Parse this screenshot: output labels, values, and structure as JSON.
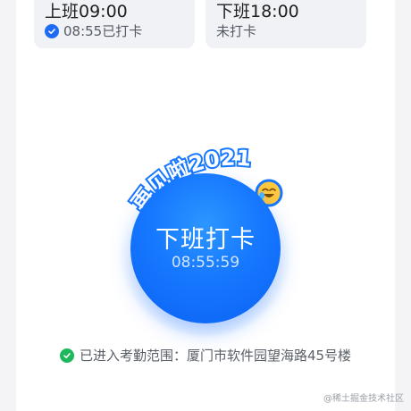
{
  "cards": {
    "clock_in": {
      "title": "上班09:00",
      "status": "08:55已打卡"
    },
    "clock_out": {
      "title": "下班18:00",
      "status": "未打卡"
    }
  },
  "clock_button": {
    "label": "下班打卡",
    "time": "08:55:59",
    "banner_text": "再见啦2021"
  },
  "location": {
    "text": "已进入考勤范围：厦门市软件园望海路45号楼"
  },
  "watermark": "@稀土掘金技术社区",
  "colors": {
    "primary": "#1677ff",
    "success": "#1fb75b"
  }
}
